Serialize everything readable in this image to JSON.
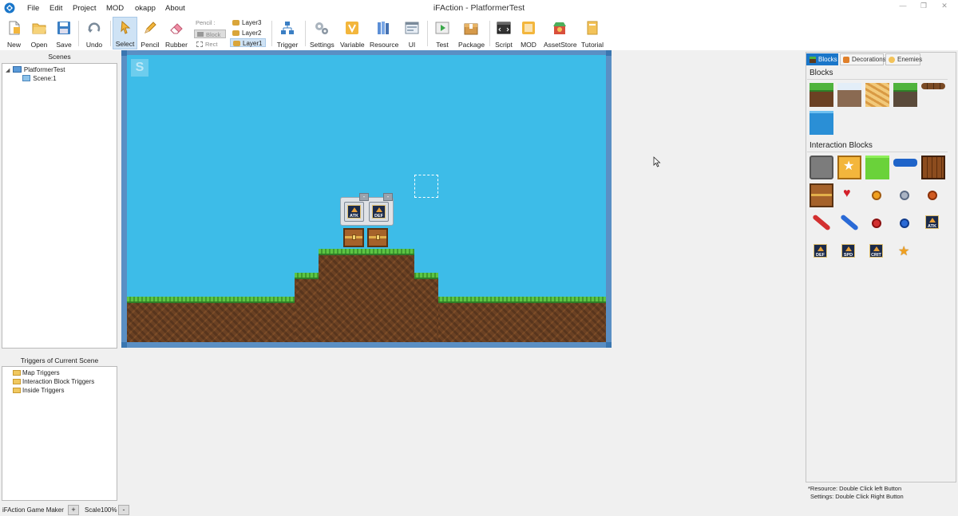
{
  "window": {
    "title": "iFAction - PlatformerTest",
    "minimize_glyph": "—",
    "restore_glyph": "❐",
    "close_glyph": "✕"
  },
  "menu": [
    "File",
    "Edit",
    "Project",
    "MOD",
    "okapp",
    "About"
  ],
  "toolbar": {
    "file_tools": [
      {
        "label": "New",
        "icon": "new-file-icon"
      },
      {
        "label": "Open",
        "icon": "open-folder-icon"
      },
      {
        "label": "Save",
        "icon": "floppy-disk-icon"
      }
    ],
    "undo_label": "Undo",
    "edit_tools": [
      {
        "label": "Select",
        "icon": "pointer-icon",
        "active": true
      },
      {
        "label": "Pencil",
        "icon": "pencil-icon"
      },
      {
        "label": "Rubber",
        "icon": "eraser-icon"
      }
    ],
    "pencil_mode": {
      "title": "Pencil :",
      "options": [
        "Block",
        "Rect"
      ],
      "selected": "Block"
    },
    "layers": [
      "Layer3",
      "Layer2",
      "Layer1"
    ],
    "selected_layer": "Layer1",
    "trigger_label": "Trigger",
    "project_tools": [
      {
        "label": "Settings",
        "icon": "gears-icon"
      },
      {
        "label": "Variable",
        "icon": "variable-icon"
      },
      {
        "label": "Resource",
        "icon": "books-icon"
      },
      {
        "label": "UI",
        "icon": "window-icon"
      }
    ],
    "run_tools": [
      {
        "label": "Test",
        "icon": "play-icon"
      },
      {
        "label": "Package",
        "icon": "package-icon"
      }
    ],
    "ext_tools": [
      {
        "label": "Script",
        "icon": "script-icon"
      },
      {
        "label": "MOD",
        "icon": "mod-icon"
      },
      {
        "label": "AssetStore",
        "icon": "store-icon"
      },
      {
        "label": "Tutorial",
        "icon": "book-icon"
      }
    ]
  },
  "scenes": {
    "title": "Scenes",
    "project": "PlatformerTest",
    "items": [
      "Scene:1"
    ]
  },
  "triggers": {
    "title": "Triggers of Current Scene",
    "items": [
      "Map Triggers",
      "Interaction Block Triggers",
      "Inside Triggers"
    ]
  },
  "canvas": {
    "spawn_label": "S",
    "items": [
      "ATK",
      "DEF"
    ],
    "collapse_glyph": "-",
    "sky_color": "#3dbce8"
  },
  "palette": {
    "tabs": [
      {
        "label": "Blocks",
        "selected": true
      },
      {
        "label": "Decorations"
      },
      {
        "label": "Enemies"
      }
    ],
    "blocks_title": "Blocks",
    "interaction_title": "Interaction Blocks",
    "item_labels": [
      "ATK",
      "DEF",
      "SPD",
      "CRIT"
    ],
    "hint_line1": "*Resource: Double Click left Button",
    "hint_line2": "Settings: Double Click Right Button"
  },
  "status": {
    "app_name": "iFAction Game Maker",
    "zoom_in": "+",
    "scale_label": "Scale100%",
    "zoom_out": "-"
  },
  "colors": {
    "accent": "#1a76c9",
    "grass": "#4fb33c",
    "dirt": "#6b4123"
  }
}
